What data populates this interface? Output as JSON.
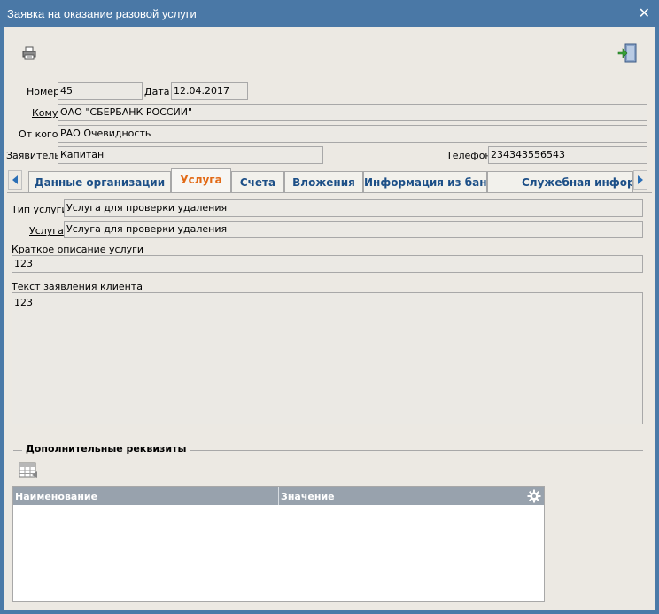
{
  "window": {
    "title": "Заявка на оказание разовой услуги"
  },
  "header": {
    "number_label": "Номер",
    "number": "45",
    "date_label": "Дата",
    "date": "12.04.2017",
    "to_label": "Кому",
    "to": "ОАО \"СБЕРБАНК РОССИИ\"",
    "from_label": "От кого",
    "from": "РАО Очевидность",
    "applicant_label": "Заявитель",
    "applicant": "Капитан",
    "phone_label": "Телефон",
    "phone": "234343556543"
  },
  "tabs": [
    {
      "label": "Данные организации"
    },
    {
      "label": "Услуга",
      "active": true
    },
    {
      "label": "Счета"
    },
    {
      "label": "Вложения"
    },
    {
      "label": "Информация из банка"
    },
    {
      "label": "Служебная информ"
    }
  ],
  "service": {
    "type_label": "Тип услуги",
    "type": "Услуга для проверки удаления",
    "service_label": "Услуга",
    "service": "Услуга для проверки удаления",
    "short_desc_label": "Краткое описание услуги",
    "short_desc": "123",
    "client_text_label": "Текст заявления клиента",
    "client_text": "123"
  },
  "extra": {
    "title": "Дополнительные реквизиты",
    "columns": [
      "Наименование",
      "Значение"
    ]
  },
  "icons": [
    "printer-icon",
    "exit-door-icon",
    "close-icon",
    "tab-left-arrow-icon",
    "tab-right-arrow-icon",
    "table-icon",
    "gear-icon"
  ],
  "colors": {
    "titlebar": "#4a78a6",
    "tab_text": "#1c4f87",
    "tab_active_text": "#e26a16",
    "grid_header": "#98a2ad"
  }
}
